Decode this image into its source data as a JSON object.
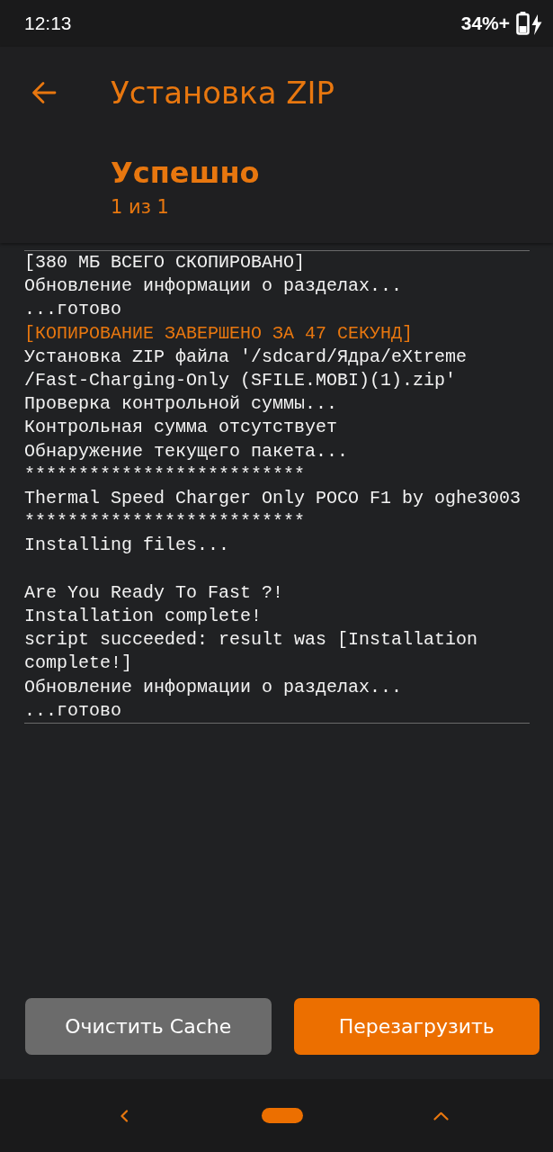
{
  "status_bar": {
    "time": "12:13",
    "battery": "34%+"
  },
  "header": {
    "title": "Установка ZIP",
    "status": "Успешно",
    "counter": "1 из 1"
  },
  "log": [
    {
      "kind": "text",
      "text": "[380 МБ ВСЕГО СКОПИРОВАНО]"
    },
    {
      "kind": "text",
      "text": "Обновление информации о разделах..."
    },
    {
      "kind": "text",
      "text": "...готово"
    },
    {
      "kind": "highlight",
      "text": "[КОПИРОВАНИЕ ЗАВЕРШЕНО ЗА 47 СЕКУНД]"
    },
    {
      "kind": "text",
      "text": "Установка ZIP файла '/sdcard/Ядра/eXtreme"
    },
    {
      "kind": "text",
      "text": "/Fast-Charging-Only (SFILE.MOBI)(1).zip'"
    },
    {
      "kind": "text",
      "text": "Проверка контрольной суммы..."
    },
    {
      "kind": "text",
      "text": "Контрольная сумма отсутствует"
    },
    {
      "kind": "text",
      "text": "Обнаружение текущего пакета..."
    },
    {
      "kind": "text",
      "text": "**************************"
    },
    {
      "kind": "text",
      "text": "Thermal Speed Charger Only POCO F1 by oghe3003"
    },
    {
      "kind": "text",
      "text": "**************************"
    },
    {
      "kind": "text",
      "text": "Installing files..."
    },
    {
      "kind": "blank"
    },
    {
      "kind": "text",
      "text": "Are You Ready To Fast ?!"
    },
    {
      "kind": "text",
      "text": "Installation complete!"
    },
    {
      "kind": "text",
      "text": "script succeeded: result was [Installation complete!]"
    },
    {
      "kind": "text",
      "text": "Обновление информации о разделах..."
    },
    {
      "kind": "text",
      "text": "...готово"
    }
  ],
  "buttons": [
    {
      "kind": "secondary",
      "label": "Очистить Cache"
    },
    {
      "kind": "primary",
      "label": "Перезагрузить"
    }
  ]
}
